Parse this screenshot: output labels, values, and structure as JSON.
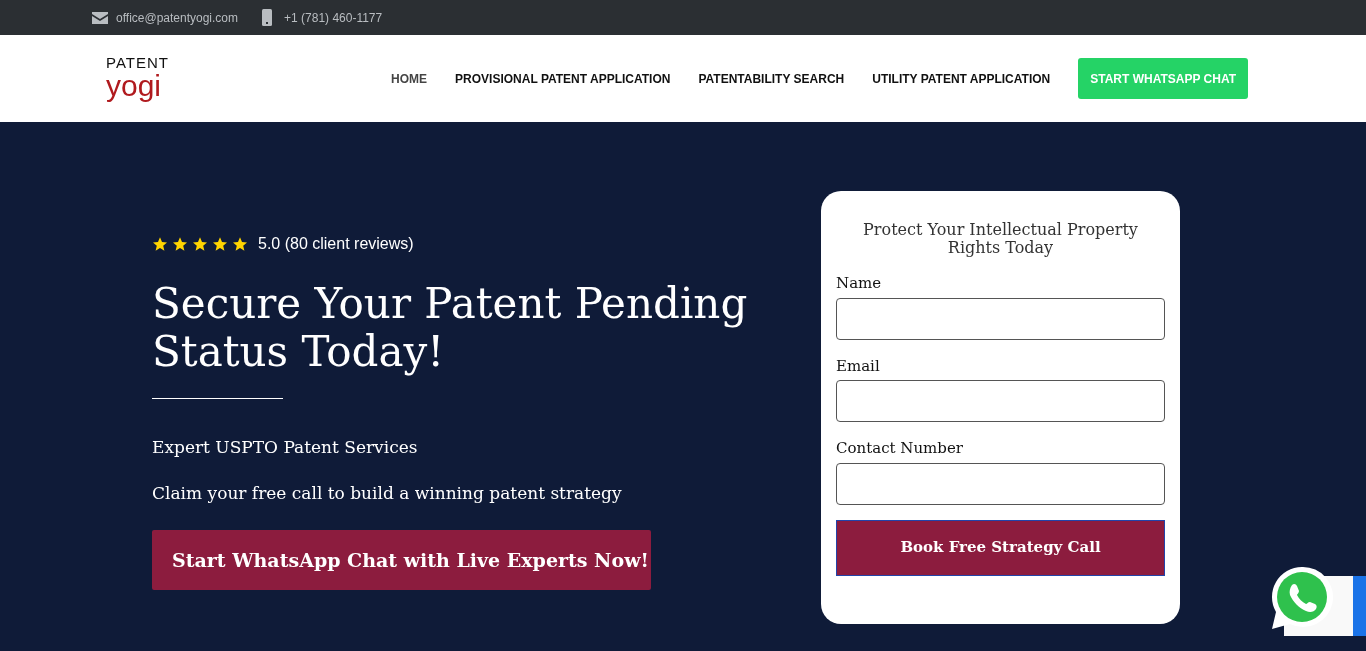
{
  "top_bar": {
    "email": "office@patentyogi.com",
    "phone": "+1 (781) 460-1177"
  },
  "logo": {
    "line_1": "PATENT",
    "line_2": "yogi"
  },
  "nav": [
    {
      "label": "HOME",
      "selected": true
    },
    {
      "label": "PROVISIONAL PATENT APPLICATION",
      "selected": false
    },
    {
      "label": "PATENTABILITY SEARCH",
      "selected": false
    },
    {
      "label": "UTILITY PATENT APPLICATION",
      "selected": false
    }
  ],
  "nav_button": "START WHATSAPP CHAT",
  "hero": {
    "stars": 5,
    "rating": "5.0 (80 client reviews)",
    "title": "Secure Your Patent Pending Status Today!",
    "subtitle": "Expert USPTO Patent Services",
    "text": "Claim your free call to build a winning patent strategy",
    "button": "Start WhatsApp Chat with Live Experts Now!"
  },
  "form": {
    "title": "Protect Your Intellectual Property Rights Today",
    "fields": [
      {
        "label": "Name"
      },
      {
        "label": "Email"
      },
      {
        "label": "Contact Number"
      }
    ],
    "submit": "Book Free Strategy Call"
  }
}
